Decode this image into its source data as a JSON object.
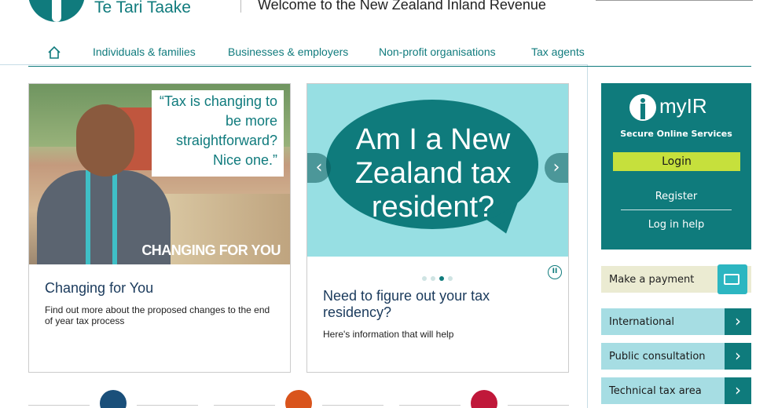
{
  "header": {
    "logo_text": "Te Tari Taake",
    "welcome": "Welcome to the New Zealand Inland Revenue"
  },
  "nav": {
    "home_icon": "home-icon",
    "items": [
      {
        "label": "Individuals & families"
      },
      {
        "label": "Businesses & employers"
      },
      {
        "label": "Non-profit organisations"
      },
      {
        "label": "Tax agents"
      }
    ]
  },
  "cards": [
    {
      "quote": "“Tax is changing to be more straightforward? Nice one.”",
      "banner": "CHANGING FOR YOU",
      "title": "Changing for You",
      "desc": "Find out more about the proposed changes to the end of year tax process"
    },
    {
      "bubble": "Am I a New Zealand tax resident?",
      "title": "Need to figure out your tax residency?",
      "desc": "Here's information that will help",
      "carousel": {
        "slides": 4,
        "active": 3
      }
    }
  ],
  "myir": {
    "name": "myIR",
    "subtitle": "Secure Online Services",
    "login": "Login",
    "register": "Register",
    "login_help": "Log in help"
  },
  "side_links": {
    "payment": "Make a payment",
    "items": [
      {
        "label": "International"
      },
      {
        "label": "Public consultation"
      },
      {
        "label": "Technical tax area"
      }
    ]
  },
  "colors": {
    "brand_teal": "#0f7b7c",
    "light_teal": "#a6dde3",
    "login_green": "#c6e03c"
  }
}
